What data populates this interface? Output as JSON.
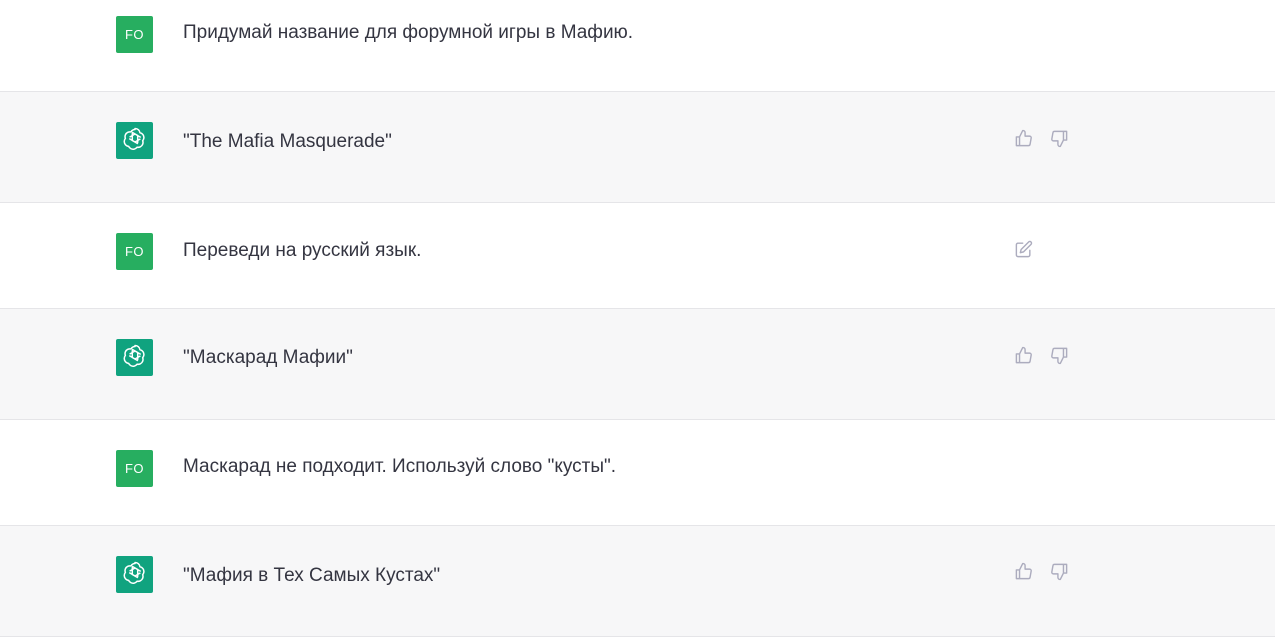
{
  "messages": [
    {
      "role": "user",
      "avatar": "FO",
      "text": "Придумай название для форумной игры  в Мафию."
    },
    {
      "role": "assistant",
      "avatar_icon": "openai-logo-icon",
      "text": "\"The Mafia Masquerade\"",
      "actions": [
        "thumbs-up-icon",
        "thumbs-down-icon"
      ]
    },
    {
      "role": "user",
      "avatar": "FO",
      "text": "Переведи на русский язык.",
      "actions": [
        "edit-icon"
      ]
    },
    {
      "role": "assistant",
      "avatar_icon": "openai-logo-icon",
      "text": "\"Маскарад Мафии\"",
      "actions": [
        "thumbs-up-icon",
        "thumbs-down-icon"
      ]
    },
    {
      "role": "user",
      "avatar": "FO",
      "text": "Маскарад не подходит. Используй слово \"кусты\"."
    },
    {
      "role": "assistant",
      "avatar_icon": "openai-logo-icon",
      "text": "\"Мафия в Тех Самых Кустах\"",
      "actions": [
        "thumbs-up-icon",
        "thumbs-down-icon"
      ]
    }
  ],
  "colors": {
    "user_avatar_bg": "#27ae60",
    "bot_avatar_bg": "#10a37f",
    "assistant_row_bg": "#f7f7f8",
    "text": "#343541",
    "icon": "#acacbe"
  }
}
